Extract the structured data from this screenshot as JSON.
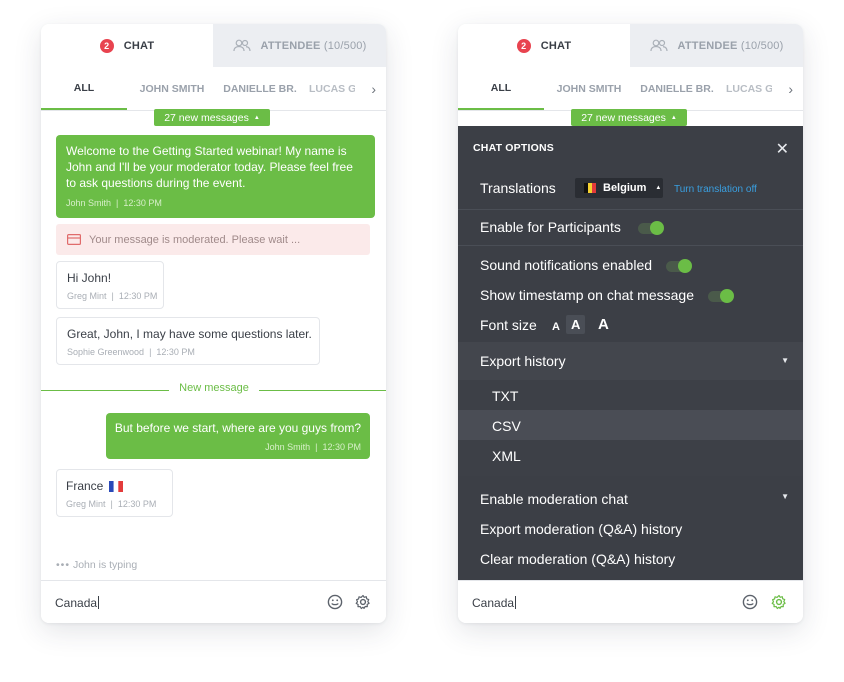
{
  "colors": {
    "accent": "#6bbd46",
    "badge": "#e8434f",
    "overlay": "#34373e"
  },
  "left": {
    "tabs": {
      "chat_label": "CHAT",
      "chat_badge": "2",
      "attendee_label": "ATTENDEE",
      "attendee_count": "(10/500)"
    },
    "subtabs": [
      "ALL",
      "JOHN SMITH",
      "DANIELLE BR.",
      "LUCAS GR"
    ],
    "new_messages": "27 new messages",
    "messages": [
      {
        "text": "Welcome to the Getting Started webinar! My name is John and I'll be your moderator today. Please feel free to ask questions during the event.",
        "author": "John Smith",
        "time": "12:30 PM"
      },
      {
        "text": "Hi John!",
        "author": "Greg Mint",
        "time": "12:30 PM"
      },
      {
        "text": "Great, John, I may have some questions later.",
        "author": "Sophie Greenwood",
        "time": "12:30 PM"
      },
      {
        "text": "But before we start, where are you guys from?",
        "author": "John Smith",
        "time": "12:30 PM"
      },
      {
        "text": "France",
        "author": "Greg Mint",
        "time": "12:30 PM"
      }
    ],
    "moderated_note": "Your message is moderated. Please wait ...",
    "new_message_divider": "New message",
    "typing": "John is typing",
    "input_value": "Canada"
  },
  "right": {
    "tabs": {
      "chat_label": "CHAT",
      "chat_badge": "2",
      "attendee_label": "ATTENDEE",
      "attendee_count": "(10/500)"
    },
    "subtabs": [
      "ALL",
      "JOHN SMITH",
      "DANIELLE BR.",
      "LUCAS GR"
    ],
    "new_messages": "27 new messages",
    "options": {
      "title": "CHAT OPTIONS",
      "translations_label": "Translations",
      "translations_lang": "Belgium",
      "translations_off": "Turn translation off",
      "enable_participants": "Enable for Participants",
      "sound_notifications": "Sound notifications enabled",
      "show_timestamp": "Show timestamp on chat message",
      "font_size_label": "Font size",
      "font_size_glyph": "A",
      "export_history": "Export history",
      "export_formats": [
        "TXT",
        "CSV",
        "XML"
      ],
      "enable_moderation": "Enable moderation chat",
      "export_moderation": "Export moderation (Q&A) history",
      "clear_moderation": "Clear moderation (Q&A) history"
    },
    "input_value": "Canada"
  }
}
